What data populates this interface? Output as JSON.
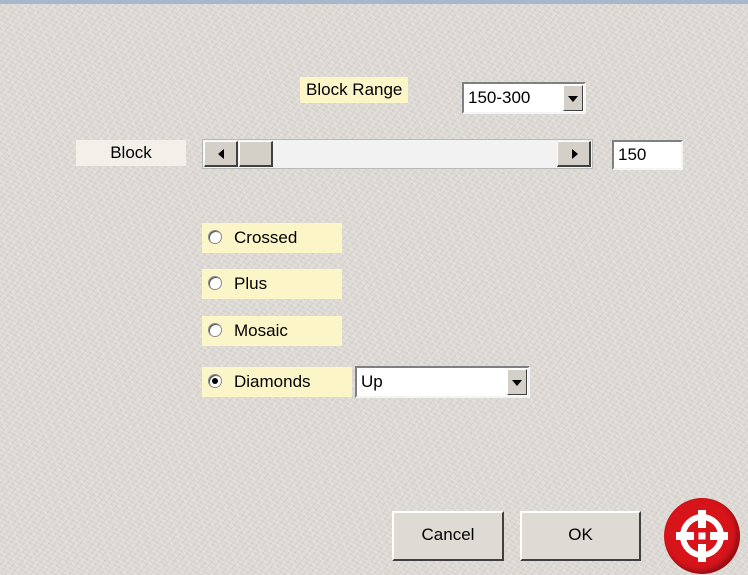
{
  "dialog": {
    "block_range": {
      "label": "Block Range",
      "value": "150-300"
    },
    "block": {
      "label": "Block",
      "value": "150"
    },
    "options": [
      {
        "label": "Crossed",
        "selected": false
      },
      {
        "label": "Plus",
        "selected": false
      },
      {
        "label": "Mosaic",
        "selected": false
      },
      {
        "label": "Diamonds",
        "selected": true
      }
    ],
    "diamonds_direction": "Up",
    "buttons": {
      "cancel": "Cancel",
      "ok": "OK"
    }
  },
  "icons": {
    "dropdown": "chevron-down-icon",
    "scroll_left": "arrow-left-icon",
    "scroll_right": "arrow-right-icon",
    "logo": "crosshair-logo-icon"
  },
  "colors": {
    "label_bg": "#fbf5c8",
    "logo": "#d8141b"
  }
}
